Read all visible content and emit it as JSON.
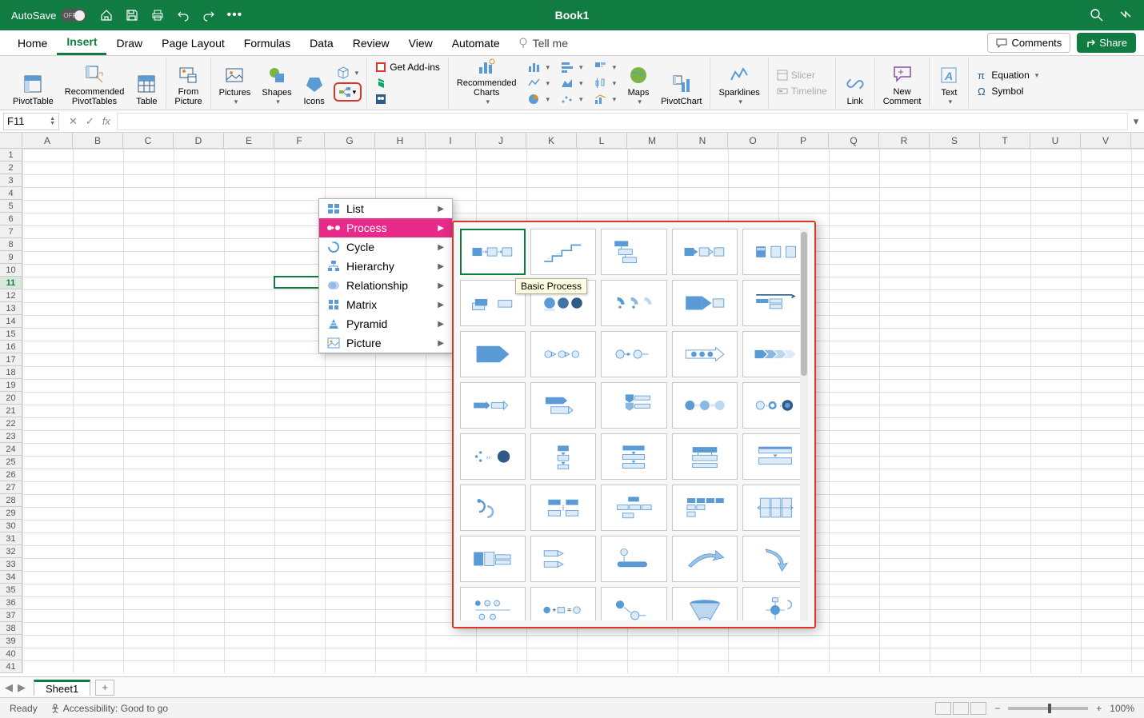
{
  "titleBar": {
    "autoSave": "AutoSave",
    "autoSaveState": "OFF",
    "bookTitle": "Book1"
  },
  "tabs": [
    "Home",
    "Insert",
    "Draw",
    "Page Layout",
    "Formulas",
    "Data",
    "Review",
    "View",
    "Automate"
  ],
  "tellMe": "Tell me",
  "comments": "Comments",
  "share": "Share",
  "ribbon": {
    "pivotTable": "PivotTable",
    "recPivot": "Recommended\nPivotTables",
    "table": "Table",
    "fromPic": "From\nPicture",
    "pictures": "Pictures",
    "shapes": "Shapes",
    "icons": "Icons",
    "addins": "Get Add-ins",
    "recCharts": "Recommended\nCharts",
    "maps": "Maps",
    "pivotChart": "PivotChart",
    "sparklines": "Sparklines",
    "slicer": "Slicer",
    "timeline": "Timeline",
    "link": "Link",
    "newComment": "New\nComment",
    "text": "Text",
    "equation": "Equation",
    "symbol": "Symbol"
  },
  "nameBox": "F11",
  "columns": [
    "A",
    "B",
    "C",
    "D",
    "E",
    "F",
    "G",
    "H",
    "I",
    "J",
    "K",
    "L",
    "M",
    "N",
    "O",
    "P",
    "Q",
    "R",
    "S",
    "T",
    "U",
    "V"
  ],
  "rows": [
    "1",
    "2",
    "3",
    "4",
    "5",
    "6",
    "7",
    "8",
    "9",
    "10",
    "11",
    "12",
    "13",
    "14",
    "15",
    "16",
    "17",
    "18",
    "19",
    "20",
    "21",
    "22",
    "23",
    "24",
    "25",
    "26",
    "27",
    "28",
    "29",
    "30",
    "31",
    "32",
    "33",
    "34",
    "35",
    "36",
    "37",
    "38",
    "39",
    "40",
    "41"
  ],
  "activeCell": {
    "row": 10,
    "col": 5
  },
  "smartArtMenu": [
    "List",
    "Process",
    "Cycle",
    "Hierarchy",
    "Relationship",
    "Matrix",
    "Pyramid",
    "Picture"
  ],
  "smartArtMenuActiveIndex": 1,
  "smartArtIcons": [
    "list",
    "process",
    "cycle",
    "hierarchy",
    "relationship",
    "matrix",
    "pyramid",
    "picture"
  ],
  "tooltip": "Basic Process",
  "galleryItems": 40,
  "sheetTab": "Sheet1",
  "status": {
    "ready": "Ready",
    "accessibility": "Accessibility: Good to go",
    "zoom": "100%"
  },
  "thumbSvgs": [
    "<svg width='68' height='40' viewBox='0 0 68 40'><rect x='4' y='14' width='14' height='12' fill='#5b9bd5'/><rect x='26' y='14' width='14' height='12' fill='#deebf7' stroke='#5b9bd5'/><rect x='48' y='14' width='14' height='12' fill='#deebf7' stroke='#5b9bd5'/><path d='M19 20 L25 20 M23 18 L25 20 L23 22' stroke='#5b9bd5' fill='none'/><path d='M41 20 L47 20 M45 18 L47 20 L45 22' stroke='#5b9bd5' fill='none'/></svg>",
    "<svg width='68' height='40' viewBox='0 0 68 40'><path d='M6 34 L18 34 L18 26 L32 26 L32 18 L46 18 L46 10 L60 10' stroke='#5b9bd5' stroke-width='2' fill='none'/><text x='10' y='32' font-size='5' fill='#5b9bd5'>—</text><text x='24' y='24' font-size='5' fill='#5b9bd5'>—</text></svg>",
    "<svg width='68' height='40' viewBox='0 0 68 40'><rect x='6' y='4' width='20' height='8' fill='#5b9bd5'/><rect x='12' y='16' width='20' height='8' fill='#deebf7' stroke='#5b9bd5'/><rect x='18' y='28' width='20' height='8' fill='#deebf7' stroke='#5b9bd5'/><path d='M16 12 L16 16 M16 16 L12 16' stroke='#5b9bd5'/><path d='M22 24 L22 28 M22 28 L18 28' stroke='#5b9bd5'/></svg>",
    "<svg width='68' height='40' viewBox='0 0 68 40'><rect x='4' y='14' width='14' height='12' fill='#5b9bd5'/><path d='M18 16 L24 20 L18 24 Z' fill='#5b9bd5'/><rect x='26' y='14' width='14' height='12' fill='#deebf7' stroke='#5b9bd5'/><path d='M40 16 L46 20 L40 24 Z' fill='#deebf7' stroke='#5b9bd5'/><rect x='48' y='14' width='14' height='12' fill='#deebf7' stroke='#5b9bd5'/></svg>",
    "<svg width='68' height='40' viewBox='0 0 68 40'><rect x='6' y='12' width='14' height='16' fill='#5b9bd5'/><rect x='7' y='14' width='12' height='4' fill='#fff' opacity='.6'/><rect x='28' y='12' width='14' height='16' fill='#deebf7' stroke='#5b9bd5'/><rect x='50' y='12' width='14' height='16' fill='#deebf7' stroke='#5b9bd5'/></svg>",
    "<svg width='68' height='40' viewBox='0 0 68 40'><rect x='4' y='20' width='18' height='10' fill='#deebf7' stroke='#5b9bd5'/><rect x='8' y='14' width='18' height='10' fill='#5b9bd5'/><rect x='42' y='16' width='20' height='10' fill='#deebf7' stroke='#5b9bd5'/></svg>",
    "<svg width='68' height='40' viewBox='0 0 68 40'><circle cx='14' cy='20' r='8' fill='#5b9bd5'/><circle cx='34' cy='20' r='8' fill='#4172a8'/><circle cx='54' cy='20' r='8' fill='#2e5a87'/><rect x='6' y='28' width='16' height='4' fill='#deebf7'/></svg>",
    "<svg width='68' height='40' viewBox='0 0 68 40'><path d='M10 14 A8 8 0 0 1 18 22' stroke='#5b9bd5' stroke-width='5' fill='none'/><path d='M30 14 A8 8 0 0 1 38 22' stroke='#8bb8e0' stroke-width='5' fill='none'/><path d='M50 14 A8 8 0 0 1 58 22' stroke='#bdd7ee' stroke-width='5' fill='none'/><circle cx='14' cy='26' r='2' fill='#5b9bd5'/><circle cx='34' cy='26' r='2' fill='#5b9bd5'/></svg>",
    "<svg width='68' height='40' viewBox='0 0 68 40'><rect x='6' y='10' width='24' height='20' fill='#5b9bd5'/><path d='M30 10 L44 20 L30 30 Z' fill='#5b9bd5'/><rect x='46' y='14' width='16' height='12' fill='#deebf7' stroke='#5b9bd5'/></svg>",
    "<svg width='68' height='40' viewBox='0 0 68 40'><path d='M6 8 L58 8 L62 10 L58 12' stroke='#2e5a87' stroke-width='2' fill='none'/><rect x='6' y='14' width='18' height='6' fill='#5b9bd5'/><rect x='26' y='14' width='18' height='6' fill='#deebf7' stroke='#5b9bd5'/><rect x='26' y='22' width='18' height='6' fill='#deebf7' stroke='#5b9bd5'/></svg>",
    "<svg width='68' height='40' viewBox='0 0 68 40'><path d='M10 8 L44 8 L44 32 L10 32 Z M44 8 L58 20 L44 32 Z' fill='#5b9bd5'/></svg>",
    "<svg width='68' height='40' viewBox='0 0 68 40'><circle cx='12' cy='20' r='5' fill='#deebf7' stroke='#5b9bd5'/><path d='M17 17 L23 20 L17 23 Z' fill='#deebf7' stroke='#5b9bd5'/><circle cx='32' cy='20' r='5' fill='#deebf7' stroke='#5b9bd5'/><path d='M37 17 L43 20 L37 23 Z' fill='#deebf7' stroke='#5b9bd5'/><circle cx='52' cy='20' r='5' fill='#deebf7' stroke='#5b9bd5'/></svg>",
    "<svg width='68' height='40' viewBox='0 0 68 40'><circle cx='14' cy='20' r='6' fill='#deebf7' stroke='#5b9bd5'/><line x1='20' y1='20' x2='30' y2='20' stroke='#5b9bd5'/><circle cx='26' cy='20' r='2' fill='#5b9bd5'/><circle cx='40' cy='20' r='6' fill='#deebf7' stroke='#5b9bd5'/><line x1='46' y1='20' x2='56' y2='20' stroke='#5b9bd5'/></svg>",
    "<svg width='68' height='40' viewBox='0 0 68 40'><path d='M6 14 L50 14 L50 10 L62 20 L50 30 L50 26 L6 26 Z' fill='none' stroke='#5b9bd5'/><circle cx='18' cy='20' r='4' fill='#5b9bd5'/><circle cx='30' cy='20' r='4' fill='#5b9bd5'/><circle cx='42' cy='20' r='4' fill='#5b9bd5'/></svg>",
    "<svg width='68' height='40' viewBox='0 0 68 40'><path d='M4 14 L16 14 L22 20 L16 26 L4 26 Z' fill='#5b9bd5'/><path d='M18 14 L30 14 L36 20 L30 26 L18 26 L24 20 Z' fill='#8bb8e0'/><path d='M32 14 L44 14 L50 20 L44 26 L32 26 L38 20 Z' fill='#bdd7ee'/><path d='M46 14 L58 14 L64 20 L58 26 L46 26 L52 20 Z' fill='#deebf7'/></svg>",
    "<svg width='68' height='40' viewBox='0 0 68 40'><rect x='6' y='16' width='18' height='8' fill='#5b9bd5'/><path d='M24 14 L30 20 L24 26 Z' fill='#5b9bd5'/><rect x='32' y='16' width='18' height='8' fill='#deebf7' stroke='#5b9bd5'/><path d='M50 14 L56 20 L50 26 Z' fill='#deebf7' stroke='#5b9bd5'/></svg>",
    "<svg width='68' height='40' viewBox='0 0 68 40'><rect x='8' y='8' width='26' height='10' fill='#5b9bd5'/><path d='M34 8 L40 13 L34 18 Z' fill='#5b9bd5'/><rect x='16' y='22' width='26' height='10' fill='#deebf7' stroke='#5b9bd5'/><path d='M42 22 L48 27 L42 32 Z' fill='#deebf7' stroke='#5b9bd5'/></svg>",
    "<svg width='68' height='40' viewBox='0 0 68 40'><path d='M22 4 L34 4 L34 12 L28 16 L22 12 Z' fill='#5b9bd5'/><rect x='36' y='6' width='22' height='6' fill='#deebf7' stroke='#5b9bd5'/><path d='M22 16 L34 16 L34 24 L28 28 L22 24 Z' fill='#8bb8e0'/><rect x='36' y='18' width='22' height='6' fill='#deebf7' stroke='#5b9bd5'/></svg>",
    "<svg width='68' height='40' viewBox='0 0 68 40'><circle cx='12' cy='20' r='7' fill='#5b9bd5'/><rect x='20' y='18' width='8' height='4' fill='#deebf7'/><circle cx='34' cy='20' r='7' fill='#8bb8e0'/><rect x='42' y='18' width='8' height='4' fill='#deebf7'/><circle cx='56' cy='20' r='7' fill='#bdd7ee'/></svg>",
    "<svg width='68' height='40' viewBox='0 0 68 40'><circle cx='12' cy='20' r='6' fill='#deebf7' stroke='#5b9bd5'/><text x='20' y='23' font-size='8' fill='#5b9bd5'>›</text><circle cx='30' cy='20' r='6' fill='#5b9bd5'/><circle cx='30' cy='20' r='3' fill='#fff'/><text x='40' y='23' font-size='8' fill='#5b9bd5'>›</text><circle cx='52' cy='20' r='8' fill='#2e5a87'/><circle cx='52' cy='20' r='4' fill='#5b9bd5'/></svg>",
    "<svg width='68' height='40' viewBox='0 0 68 40'><circle cx='10' cy='20' r='2' fill='#5b9bd5'/><circle cx='16' cy='14' r='2' fill='#5b9bd5'/><circle cx='16' cy='26' r='2' fill='#5b9bd5'/><text x='24' y='24' font-size='10' fill='#5b9bd5'>››</text><circle cx='50' cy='20' r='9' fill='#2e5a87'/></svg>",
    "<svg width='68' height='40' viewBox='0 0 68 40'><rect x='26' y='4' width='16' height='8' fill='#5b9bd5'/><path d='M31 14 L37 14 L34 18 Z' fill='#5b9bd5'/><rect x='26' y='18' width='16' height='8' fill='#deebf7' stroke='#5b9bd5'/><path d='M31 28 L37 28 L34 32 Z' fill='#5b9bd5'/><rect x='26' y='32' width='16' height='6' fill='#deebf7' stroke='#5b9bd5'/></svg>",
    "<svg width='68' height='40' viewBox='0 0 68 40'><rect x='18' y='4' width='32' height='7' fill='#5b9bd5'/><path d='M31 13 L37 13 L34 17 Z' fill='#5b9bd5'/><rect x='18' y='17' width='32' height='7' fill='#deebf7' stroke='#5b9bd5'/><path d='M31 26 L37 26 L34 30 Z' fill='#5b9bd5'/><rect x='18' y='30' width='32' height='7' fill='#deebf7' stroke='#5b9bd5'/></svg>",
    "<svg width='68' height='40' viewBox='0 0 68 40'><rect x='16' y='6' width='36' height='8' fill='#5b9bd5'/><rect x='16' y='18' width='36' height='8' fill='#deebf7' stroke='#5b9bd5'/><rect x='16' y='30' width='36' height='6' fill='#deebf7' stroke='#5b9bd5'/><line x1='24' y1='14' x2='24' y2='18' stroke='#5b9bd5'/><line x1='44' y1='14' x2='44' y2='18' stroke='#5b9bd5'/></svg>",
    "<svg width='68' height='40' viewBox='0 0 68 40'><rect x='10' y='6' width='48' height='9' fill='#deebf7' stroke='#5b9bd5'/><path d='M31 17 L37 17 L34 21 Z' fill='#5b9bd5'/><rect x='10' y='22' width='48' height='9' fill='#deebf7' stroke='#5b9bd5'/><rect x='10' y='6' width='48' height='3' fill='#5b9bd5'/></svg>",
    "<svg width='68' height='40' viewBox='0 0 68 40'><path d='M14 10 A8 8 0 1 1 14 26' stroke='#5b9bd5' stroke-width='3' fill='none'/><path d='M26 18 A8 8 0 1 1 26 34' stroke='#8bb8e0' stroke-width='3' fill='none'/><circle cx='14' cy='10' r='3' fill='#5b9bd5'/></svg>",
    "<svg width='68' height='40' viewBox='0 0 68 40'><rect x='12' y='8' width='18' height='8' fill='#5b9bd5'/><rect x='38' y='8' width='18' height='8' fill='#5b9bd5'/><rect x='12' y='24' width='18' height='8' fill='#deebf7' stroke='#5b9bd5'/><rect x='38' y='24' width='18' height='8' fill='#deebf7' stroke='#5b9bd5'/><line x1='34' y1='16' x2='34' y2='24' stroke='#5b9bd5'/></svg>",
    "<svg width='68' height='40' viewBox='0 0 68 40'><rect x='26' y='4' width='16' height='7' fill='#5b9bd5'/><rect x='10' y='16' width='16' height='7' fill='#deebf7' stroke='#5b9bd5'/><rect x='28' y='16' width='16' height='7' fill='#deebf7' stroke='#5b9bd5'/><rect x='46' y='16' width='14' height='7' fill='#deebf7' stroke='#5b9bd5'/><rect x='18' y='28' width='16' height='7' fill='#deebf7' stroke='#5b9bd5'/></svg>",
    "<svg width='68' height='40' viewBox='0 0 68 40'><rect x='8' y='6' width='12' height='7' fill='#5b9bd5'/><rect x='22' y='6' width='12' height='7' fill='#5b9bd5'/><rect x='36' y='6' width='12' height='7' fill='#5b9bd5'/><rect x='50' y='6' width='12' height='7' fill='#5b9bd5'/><rect x='8' y='16' width='12' height='7' fill='#deebf7' stroke='#5b9bd5'/><rect x='22' y='16' width='12' height='7' fill='#deebf7' stroke='#5b9bd5'/><rect x='8' y='26' width='12' height='7' fill='#deebf7' stroke='#5b9bd5'/></svg>",
    "<svg width='68' height='40' viewBox='0 0 68 40'><rect x='12' y='6' width='14' height='28' fill='#deebf7' stroke='#5b9bd5'/><rect x='28' y='6' width='14' height='28' fill='#deebf7' stroke='#5b9bd5'/><rect x='44' y='6' width='14' height='28' fill='#deebf7' stroke='#5b9bd5'/><path d='M8 20 L60 20 M56 17 L60 20 L56 23 M12 17 L8 20 L12 23' stroke='#5b9bd5' fill='none'/></svg>",
    "<svg width='68' height='40' viewBox='0 0 68 40'><rect x='6' y='10' width='14' height='20' fill='#5b9bd5'/><rect x='22' y='10' width='14' height='20' fill='#deebf7' stroke='#5b9bd5'/><rect x='38' y='14' width='22' height='6' fill='#deebf7' stroke='#5b9bd5'/><rect x='38' y='22' width='22' height='6' fill='#deebf7' stroke='#5b9bd5'/></svg>",
    "<svg width='68' height='40' viewBox='0 0 68 40'><rect x='6' y='8' width='20' height='8' fill='#deebf7' stroke='#5b9bd5'/><path d='M26 8 L34 12 L26 16 Z' fill='#deebf7' stroke='#5b9bd5'/><rect x='6' y='24' width='20' height='8' fill='#deebf7' stroke='#5b9bd5'/><path d='M26 24 L34 28 L26 32 Z' fill='#deebf7' stroke='#5b9bd5'/></svg>",
    "<svg width='68' height='40' viewBox='0 0 68 40'><circle cx='20' cy='10' r='5' fill='#deebf7' stroke='#5b9bd5'/><line x1='20' y1='16' x2='20' y2='24' stroke='#5b9bd5'/><rect x='10' y='24' width='44' height='8' rx='4' fill='#5b9bd5'/></svg>",
    "<svg width='68' height='40' viewBox='0 0 68 40'><path d='M10 30 Q30 8 50 14 L50 8 L62 18 L46 22 L50 18 Q32 14 14 32 Z' fill='#9dc3e6' stroke='#5b9bd5'/></svg>",
    "<svg width='68' height='40' viewBox='0 0 68 40'><path d='M20 6 Q44 10 46 28 L52 26 L44 38 L38 26 L42 28 Q40 14 22 10 Z' fill='#9dc3e6' stroke='#5b9bd5'/></svg>",
    "<svg width='68' height='40' viewBox='0 0 68 40'><circle cx='12' cy='10' r='4' fill='#5b9bd5'/><circle cx='26' cy='10' r='4' fill='#deebf7' stroke='#5b9bd5'/><circle cx='40' cy='10' r='4' fill='#deebf7' stroke='#5b9bd5'/><line x1='8' y1='20' x2='60' y2='20' stroke='#5b9bd5'/><circle cx='18' cy='30' r='4' fill='#deebf7' stroke='#5b9bd5'/><circle cx='34' cy='30' r='4' fill='#deebf7' stroke='#5b9bd5'/></svg>",
    "<svg width='68' height='40' viewBox='0 0 68 40'><circle cx='10' cy='20' r='5' fill='#5b9bd5'/><text x='18' y='23' font-size='10'>+</text><rect x='26' y='16' width='10' height='8' fill='#deebf7' stroke='#5b9bd5'/><text x='40' y='23' font-size='10'>=</text><circle cx='54' cy='20' r='5' fill='#deebf7' stroke='#5b9bd5'/></svg>",
    "<svg width='68' height='40' viewBox='0 0 68 40'><circle cx='14' cy='12' r='6' fill='#5b9bd5'/><line x1='20' y1='16' x2='30' y2='24' stroke='#5b9bd5'/><circle cx='36' cy='28' r='6' fill='#deebf7' stroke='#5b9bd5'/><line x1='42' y1='28' x2='52' y2='28' stroke='#5b9bd5'/></svg>",
    "<svg width='68' height='40' viewBox='0 0 68 40'><ellipse cx='34' cy='10' rx='22' ry='5' fill='#5b9bd5'/><path d='M12 10 L26 34 L42 34 L56 10' fill='#bdd7ee' stroke='#5b9bd5'/><ellipse cx='34' cy='34' rx='8' ry='3' fill='#deebf7' stroke='#5b9bd5'/></svg>",
    "<svg width='68' height='40' viewBox='0 0 68 40'><circle cx='34' cy='20' r='7' fill='#5b9bd5'/><path d='M34 13 L34 6 M34 27 L34 34 M27 20 L20 20 M41 20 L48 20' stroke='#5b9bd5'/><path d='M30 2 L38 2 L38 8 L30 8 Z' fill='#deebf7' stroke='#5b9bd5'/><path d='M52 6 A6 6 0 1 1 52 18' stroke='#8bb8e0' stroke-width='2' fill='none'/></svg>"
  ]
}
